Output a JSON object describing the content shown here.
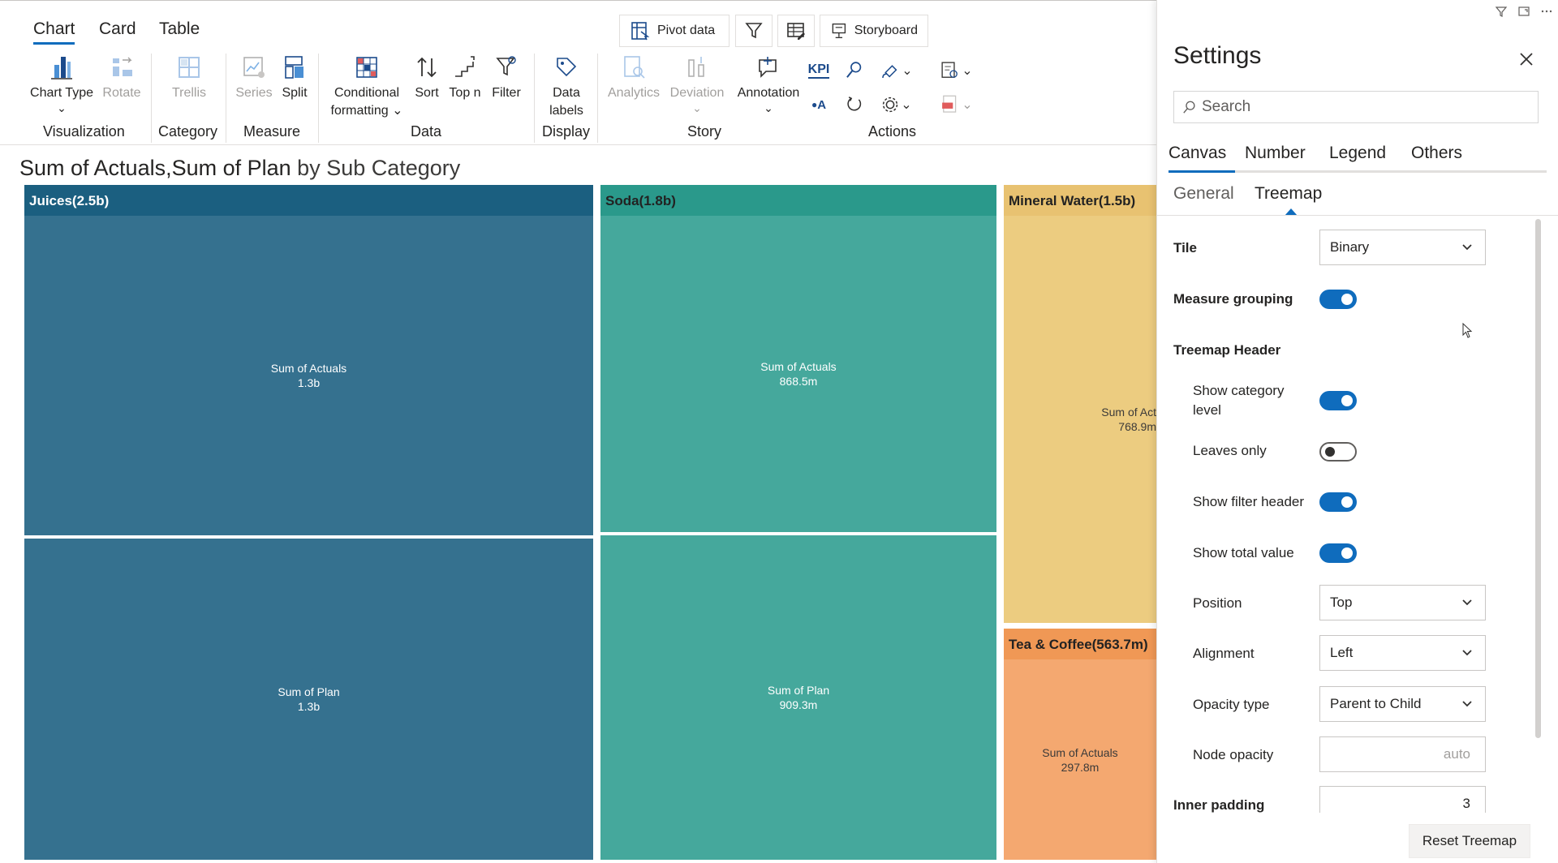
{
  "ribbon": {
    "main_tabs": [
      "Chart",
      "Card",
      "Table"
    ],
    "top_buttons": {
      "pivot": "Pivot data",
      "storyboard": "Storyboard"
    },
    "items": {
      "chart_type": "Chart Type",
      "rotate": "Rotate",
      "trellis": "Trellis",
      "series": "Series",
      "split": "Split",
      "conditional_1": "Conditional",
      "conditional_2": "formatting",
      "sort": "Sort",
      "top_n": "Top n",
      "filter": "Filter",
      "data_labels_1": "Data",
      "data_labels_2": "labels",
      "analytics": "Analytics",
      "deviation": "Deviation",
      "annotation": "Annotation",
      "kpi": "KPI",
      "oa": "A"
    },
    "groups": [
      "Visualization",
      "Category",
      "Measure",
      "Data",
      "Display",
      "Story",
      "Actions"
    ]
  },
  "chart": {
    "title_main": "Sum of Actuals,Sum of Plan",
    "title_sub": " by Sub Category",
    "colors": {
      "juices": "#35718f",
      "juices_head": "#1b5f80",
      "soda": "#45a89c",
      "soda_head": "#2a998b",
      "mineral": "#eccc80",
      "mineral_head": "#e8c271",
      "tea": "#f4a870",
      "tea_head": "#f09855"
    }
  },
  "chart_data": {
    "type": "treemap",
    "categories": [
      {
        "name": "Juices",
        "total": "2.5b",
        "header": "Juices(2.5b)",
        "children": [
          {
            "name": "Sum of Actuals",
            "value": "1.3b"
          },
          {
            "name": "Sum of Plan",
            "value": "1.3b"
          }
        ]
      },
      {
        "name": "Soda",
        "total": "1.8b",
        "header": "Soda(1.8b)",
        "children": [
          {
            "name": "Sum of Actuals",
            "value": "868.5m"
          },
          {
            "name": "Sum of Plan",
            "value": "909.3m"
          }
        ]
      },
      {
        "name": "Mineral Water",
        "total": "1.5b",
        "header": "Mineral Water(1.5b)",
        "children": [
          {
            "name": "Sum of Act",
            "value": "768.9m"
          }
        ]
      },
      {
        "name": "Tea & Coffee",
        "total": "563.7m",
        "header": "Tea & Coffee(563.7m)",
        "children": [
          {
            "name": "Sum of Actuals",
            "value": "297.8m"
          }
        ]
      }
    ]
  },
  "settings": {
    "title": "Settings",
    "search_placeholder": "Search",
    "tabs": [
      "Canvas",
      "Number",
      "Legend",
      "Others"
    ],
    "subtabs": [
      "General",
      "Treemap"
    ],
    "tile_label": "Tile",
    "tile_value": "Binary",
    "measure_grouping": "Measure grouping",
    "treemap_header": "Treemap Header",
    "show_category_level_1": "Show category",
    "show_category_level_2": "level",
    "leaves_only": "Leaves only",
    "show_filter_header": "Show filter header",
    "show_total_value": "Show total value",
    "position_label": "Position",
    "position_value": "Top",
    "alignment_label": "Alignment",
    "alignment_value": "Left",
    "opacity_type_label": "Opacity type",
    "opacity_type_value": "Parent to Child",
    "node_opacity_label": "Node opacity",
    "node_opacity_value": "auto",
    "inner_padding_label": "Inner padding",
    "inner_padding_value": "3",
    "reset_button": "Reset Treemap",
    "toggles": {
      "measure_grouping": true,
      "show_category_level": true,
      "leaves_only": false,
      "show_filter_header": true,
      "show_total_value": true
    }
  }
}
